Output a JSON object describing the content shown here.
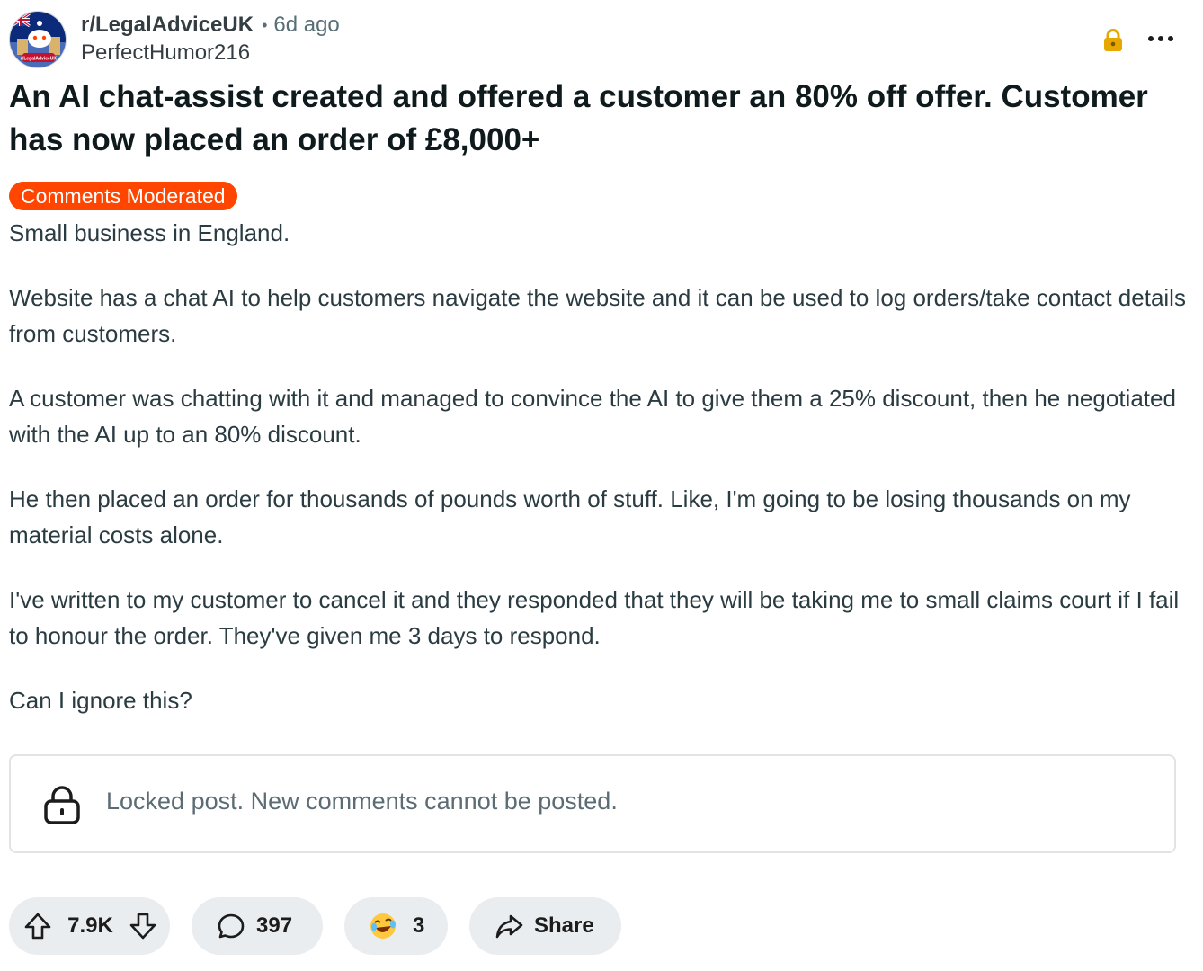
{
  "header": {
    "subreddit": "r/LegalAdviceUK",
    "separator": "•",
    "time_ago": "6d ago",
    "author": "PerfectHumor216",
    "avatar_text": "r/LegalAdviceUK",
    "avatar_icon": "subreddit-avatar-icon",
    "lock_icon": "lock-icon",
    "more_icon": "more-options-icon"
  },
  "post": {
    "title": "An AI chat-assist created and offered a customer an 80% off offer. Customer has now placed an order of £8,000+",
    "flair": "Comments Moderated",
    "body": [
      "Small business in England.",
      "Website has a chat AI to help customers navigate the website and it can be used to log orders/take contact details from customers.",
      "A customer was chatting with it and managed to convince the AI to give them a 25% discount, then he negotiated with the AI up to an 80% discount.",
      "He then placed an order for thousands of pounds worth of stuff. Like, I'm going to be losing thousands on my material costs alone.",
      "I've written to my customer to cancel it and they responded that they will be taking me to small claims court if I fail to honour the order. They've given me 3 days to respond.",
      "Can I ignore this?"
    ]
  },
  "locked_notice": {
    "text": "Locked post. New comments cannot be posted.",
    "icon": "lock-icon"
  },
  "actions": {
    "upvote_icon": "upvote-icon",
    "score": "7.9K",
    "downvote_icon": "downvote-icon",
    "comment_icon": "comment-icon",
    "comments": "397",
    "award_icon": "award-icon",
    "awards": "3",
    "share_icon": "share-icon",
    "share_label": "Share"
  },
  "colors": {
    "flair_bg": "#ff4500",
    "lock_accent": "#e6a700",
    "pill_bg": "#eaedef",
    "avatar_bg": "#0c2a7a"
  }
}
